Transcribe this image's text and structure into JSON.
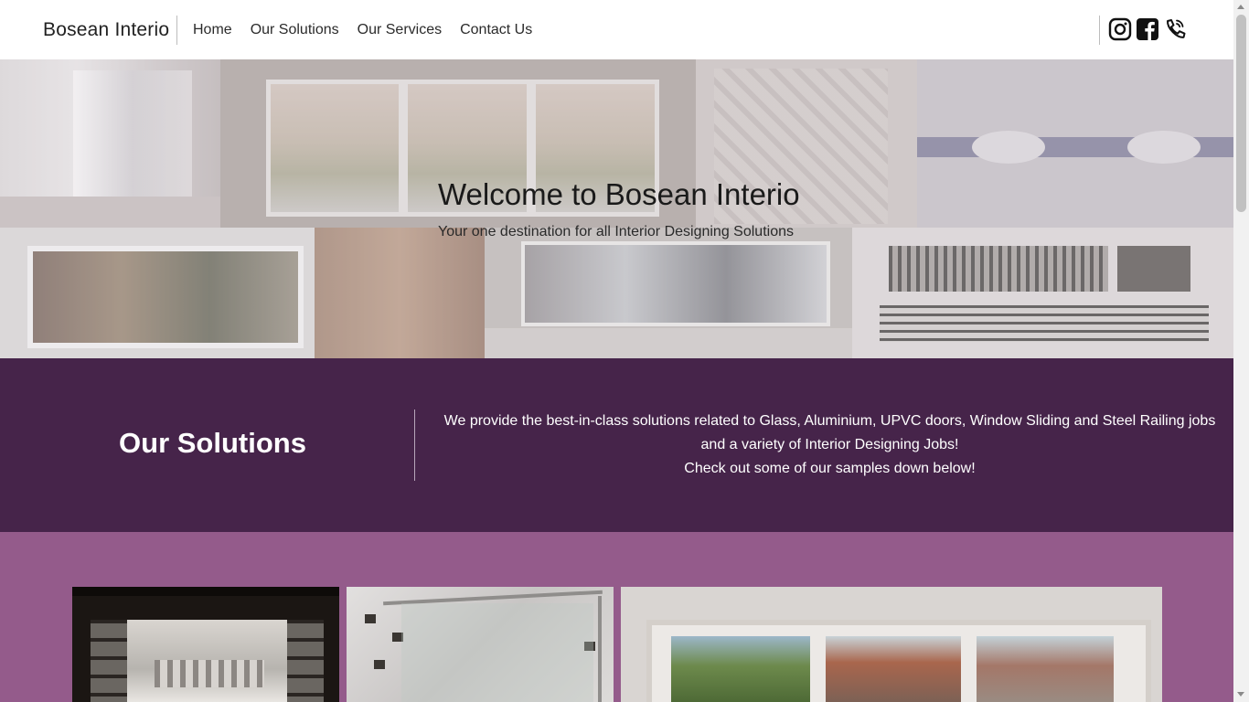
{
  "navbar": {
    "brand": "Bosean Interio",
    "links": [
      "Home",
      "Our Solutions",
      "Our Services",
      "Contact Us"
    ],
    "social_icons": [
      "instagram-icon",
      "facebook-icon",
      "phone-icon"
    ]
  },
  "hero": {
    "title": "Welcome to Bosean Interio",
    "subtitle": "Your one destination for all Interior Designing Solutions"
  },
  "solutions": {
    "heading": "Our Solutions",
    "lines": [
      "We provide the best-in-class solutions related to Glass, Aluminium, UPVC doors, Window Sliding and Steel Railing jobs",
      "and a variety of Interior Designing Jobs!",
      "Check out some of our samples down below!"
    ]
  },
  "colors": {
    "solutions_bg": "#46244a",
    "gallery_bg": "#945b8b",
    "navbar_bg": "#ffffff"
  }
}
